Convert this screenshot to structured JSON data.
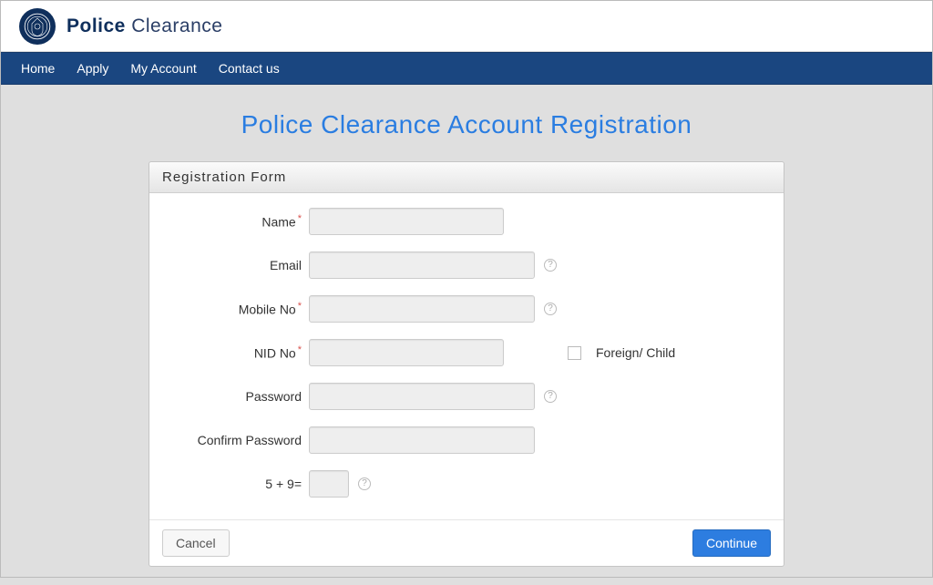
{
  "brand": {
    "strong": "Police",
    "light": " Clearance"
  },
  "nav": {
    "home": "Home",
    "apply": "Apply",
    "account": "My Account",
    "contact": "Contact us"
  },
  "page": {
    "title": "Police Clearance Account Registration"
  },
  "panel": {
    "title": "Registration Form"
  },
  "form": {
    "name_label": "Name",
    "email_label": "Email",
    "mobile_label": "Mobile No",
    "nid_label": "NID No",
    "foreign_label": "Foreign/ Child",
    "password_label": "Password",
    "confirm_label": "Confirm Password",
    "captcha_label": "5 + 9=",
    "required_mark": "*"
  },
  "buttons": {
    "cancel": "Cancel",
    "continue": "Continue"
  }
}
